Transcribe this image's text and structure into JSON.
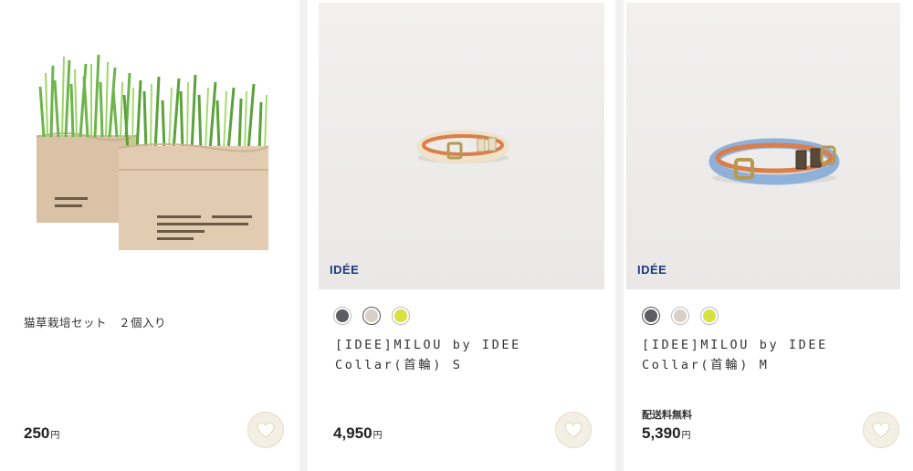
{
  "products": [
    {
      "title": "猫草栽培セット　２個入り",
      "price": "250",
      "currency": "円",
      "image_subject": "cat-grass-paper-bags"
    },
    {
      "brand": "IDÉE",
      "title": "[IDEE]MILOU by IDEE Collar(首輪) S",
      "price": "4,950",
      "currency": "円",
      "image_subject": "leather-collar-small",
      "swatches": [
        {
          "color": "#5c5c63",
          "selected": false
        },
        {
          "color": "#d9cfc6",
          "selected": true
        },
        {
          "color": "#d7e240",
          "selected": false
        }
      ]
    },
    {
      "brand": "IDÉE",
      "title": "[IDEE]MILOU by IDEE Collar(首輪) M",
      "shipping_label": "配送料無料",
      "price": "5,390",
      "currency": "円",
      "image_subject": "leather-collar-blue-medium",
      "swatches": [
        {
          "color": "#5c5c63",
          "selected": true
        },
        {
          "color": "#d9cfc6",
          "selected": false
        },
        {
          "color": "#d7e240",
          "selected": false
        }
      ]
    }
  ],
  "colors": {
    "brand_logo": "#1b3a7a",
    "favorite_button_bg": "#f4efe4",
    "favorite_heart": "#ffffff"
  },
  "icons": {
    "favorite": "heart-icon"
  }
}
